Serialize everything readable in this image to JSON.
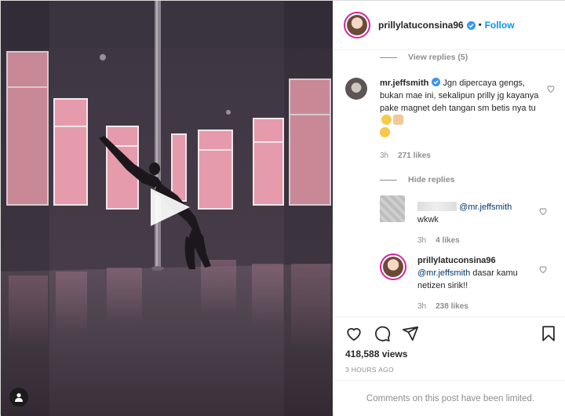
{
  "post": {
    "author": "prillylatuconsina96",
    "follow_label": "Follow",
    "dot": "•"
  },
  "comments": {
    "view_replies_label": "View replies (5)",
    "hide_replies_label": "Hide replies",
    "main": {
      "username": "mr.jeffsmith",
      "text": "Jgn dipercaya gengs, bukan mae ini, sekalipun prilly jg kayanya pake magnet deh tangan sm betis nya tu",
      "time": "3h",
      "likes": "271 likes"
    },
    "replies": [
      {
        "mention": "@mr.jeffsmith",
        "text": "wkwk",
        "time": "3h",
        "likes": "4 likes"
      },
      {
        "username": "prillylatuconsina96",
        "mention": "@mr.jeffsmith",
        "text": "dasar kamu netizen sirik!!",
        "time": "3h",
        "likes": "238 likes"
      }
    ]
  },
  "stats": {
    "views": "418,588 views",
    "posted": "3 HOURS AGO"
  },
  "footer": {
    "limited_text": "Comments on this post have been limited."
  },
  "icons": {
    "play": "play-icon",
    "user_tag": "user-icon",
    "like": "heart-icon",
    "comment": "comment-icon",
    "share": "paper-plane-icon",
    "save": "bookmark-icon",
    "verified": "verified-badge-icon"
  },
  "colors": {
    "link_blue": "#0095f6",
    "mention_blue": "#00376b",
    "muted_gray": "#8e8e8e",
    "window_pink": "#e79aa8"
  }
}
